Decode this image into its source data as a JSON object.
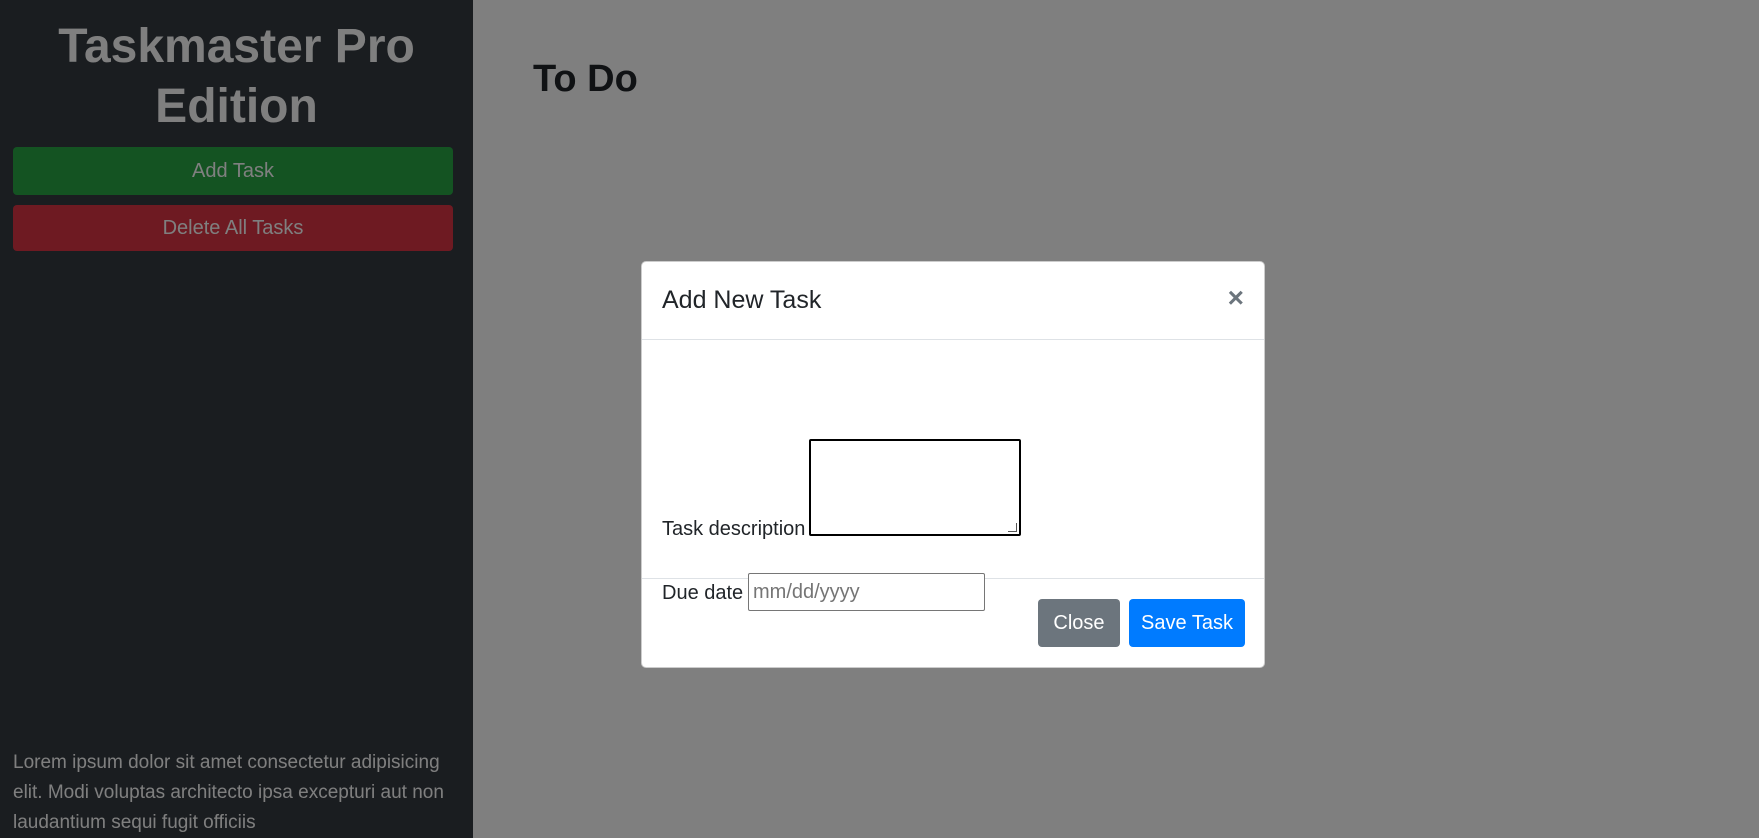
{
  "sidebar": {
    "title": "Taskmaster Pro Edition",
    "add_task_label": "Add Task",
    "delete_all_label": "Delete All Tasks",
    "footer_text": "Lorem ipsum dolor sit amet consectetur adipisicing elit. Modi voluptas architecto ipsa excepturi aut non laudantium sequi fugit officiis"
  },
  "main": {
    "heading": "To Do"
  },
  "modal": {
    "title": "Add New Task",
    "close_icon": "×",
    "description_label": "Task description",
    "description_value": "",
    "due_date_label": "Due date",
    "due_date_placeholder": "mm/dd/yyyy",
    "close_button_label": "Close",
    "save_button_label": "Save Task"
  },
  "colors": {
    "sidebar_bg": "#343a40",
    "add_button": "#28a745",
    "delete_button": "#dc3545",
    "close_button": "#6c757d",
    "save_button": "#007bff"
  }
}
